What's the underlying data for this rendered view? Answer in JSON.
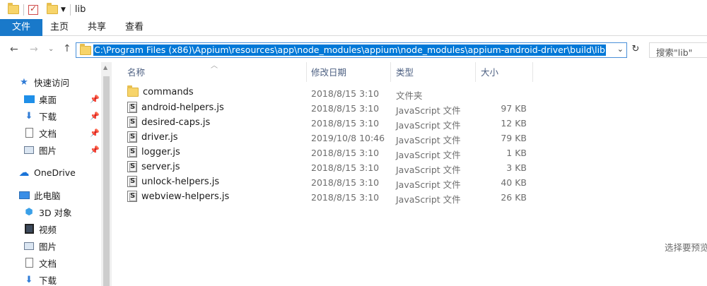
{
  "window": {
    "title": "lib"
  },
  "ribbon": {
    "tabs": [
      "文件",
      "主页",
      "共享",
      "查看"
    ]
  },
  "address": {
    "path": "C:\\Program Files (x86)\\Appium\\resources\\app\\node_modules\\appium\\node_modules\\appium-android-driver\\build\\lib"
  },
  "search": {
    "placeholder": "搜索\"lib\""
  },
  "nav": {
    "quick_access": "快速访问",
    "items": [
      "桌面",
      "下载",
      "文档",
      "图片"
    ],
    "onedrive": "OneDrive",
    "this_pc": "此电脑",
    "pc_items": [
      "3D 对象",
      "视频",
      "图片",
      "文档",
      "下载"
    ]
  },
  "columns": {
    "name": "名称",
    "date": "修改日期",
    "type": "类型",
    "size": "大小"
  },
  "files": [
    {
      "name": "commands",
      "date": "2018/8/15 3:10",
      "type": "文件夹",
      "size": "",
      "icon": "folder-icon"
    },
    {
      "name": "android-helpers.js",
      "date": "2018/8/15 3:10",
      "type": "JavaScript 文件",
      "size": "97 KB",
      "icon": "js-file-icon"
    },
    {
      "name": "desired-caps.js",
      "date": "2018/8/15 3:10",
      "type": "JavaScript 文件",
      "size": "12 KB",
      "icon": "js-file-icon"
    },
    {
      "name": "driver.js",
      "date": "2019/10/8 10:46",
      "type": "JavaScript 文件",
      "size": "79 KB",
      "icon": "js-file-icon"
    },
    {
      "name": "logger.js",
      "date": "2018/8/15 3:10",
      "type": "JavaScript 文件",
      "size": "1 KB",
      "icon": "js-file-icon"
    },
    {
      "name": "server.js",
      "date": "2018/8/15 3:10",
      "type": "JavaScript 文件",
      "size": "3 KB",
      "icon": "js-file-icon"
    },
    {
      "name": "unlock-helpers.js",
      "date": "2018/8/15 3:10",
      "type": "JavaScript 文件",
      "size": "40 KB",
      "icon": "js-file-icon"
    },
    {
      "name": "webview-helpers.js",
      "date": "2018/8/15 3:10",
      "type": "JavaScript 文件",
      "size": "26 KB",
      "icon": "js-file-icon"
    }
  ],
  "preview_hint": "选择要预览",
  "colors": {
    "accent": "#1979ca",
    "selection": "#0078d7"
  }
}
